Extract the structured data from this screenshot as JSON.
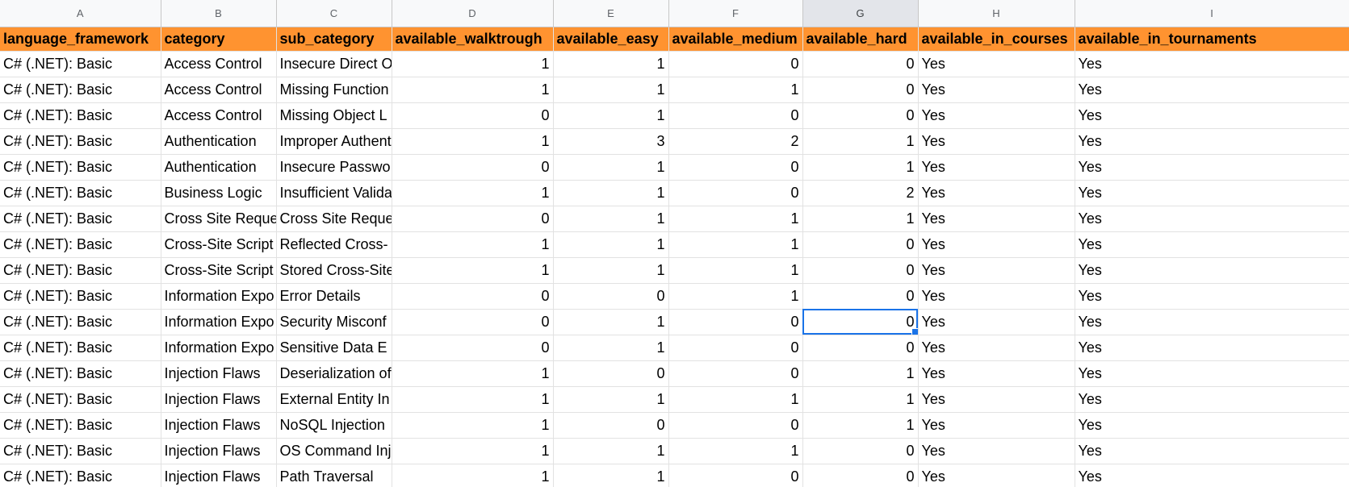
{
  "columns": [
    "A",
    "B",
    "C",
    "D",
    "E",
    "F",
    "G",
    "H",
    "I"
  ],
  "headers": [
    "language_framework",
    "category",
    "sub_category",
    "available_walktrough",
    "available_easy",
    "available_medium",
    "available_hard",
    "available_in_courses",
    "available_in_tournaments"
  ],
  "rows": [
    [
      "C# (.NET): Basic",
      "Access Control",
      "Insecure Direct O",
      "1",
      "1",
      "0",
      "0",
      "Yes",
      "Yes"
    ],
    [
      "C# (.NET): Basic",
      "Access Control",
      "Missing Function",
      "1",
      "1",
      "1",
      "0",
      "Yes",
      "Yes"
    ],
    [
      "C# (.NET): Basic",
      "Access Control",
      "Missing Object L",
      "0",
      "1",
      "0",
      "0",
      "Yes",
      "Yes"
    ],
    [
      "C# (.NET): Basic",
      "Authentication",
      "Improper Authent",
      "1",
      "3",
      "2",
      "1",
      "Yes",
      "Yes"
    ],
    [
      "C# (.NET): Basic",
      "Authentication",
      "Insecure Passwo",
      "0",
      "1",
      "0",
      "1",
      "Yes",
      "Yes"
    ],
    [
      "C# (.NET): Basic",
      "Business Logic",
      "Insufficient Valida",
      "1",
      "1",
      "0",
      "2",
      "Yes",
      "Yes"
    ],
    [
      "C# (.NET): Basic",
      "Cross Site Reque",
      "Cross Site Reque",
      "0",
      "1",
      "1",
      "1",
      "Yes",
      "Yes"
    ],
    [
      "C# (.NET): Basic",
      "Cross-Site Script",
      "Reflected Cross-",
      "1",
      "1",
      "1",
      "0",
      "Yes",
      "Yes"
    ],
    [
      "C# (.NET): Basic",
      "Cross-Site Script",
      "Stored Cross-Site",
      "1",
      "1",
      "1",
      "0",
      "Yes",
      "Yes"
    ],
    [
      "C# (.NET): Basic",
      "Information Expo",
      "Error Details",
      "0",
      "0",
      "1",
      "0",
      "Yes",
      "Yes"
    ],
    [
      "C# (.NET): Basic",
      "Information Expo",
      "Security Misconf",
      "0",
      "1",
      "0",
      "0",
      "Yes",
      "Yes"
    ],
    [
      "C# (.NET): Basic",
      "Information Expo",
      "Sensitive Data E",
      "0",
      "1",
      "0",
      "0",
      "Yes",
      "Yes"
    ],
    [
      "C# (.NET): Basic",
      "Injection Flaws",
      "Deserialization of",
      "1",
      "0",
      "0",
      "1",
      "Yes",
      "Yes"
    ],
    [
      "C# (.NET): Basic",
      "Injection Flaws",
      "External Entity In",
      "1",
      "1",
      "1",
      "1",
      "Yes",
      "Yes"
    ],
    [
      "C# (.NET): Basic",
      "Injection Flaws",
      "NoSQL Injection",
      "1",
      "0",
      "0",
      "1",
      "Yes",
      "Yes"
    ],
    [
      "C# (.NET): Basic",
      "Injection Flaws",
      "OS Command Inj",
      "1",
      "1",
      "1",
      "0",
      "Yes",
      "Yes"
    ],
    [
      "C# (.NET): Basic",
      "Injection Flaws",
      "Path Traversal",
      "1",
      "1",
      "0",
      "0",
      "Yes",
      "Yes"
    ]
  ],
  "colors": {
    "header_fill": "#ff9330",
    "selection": "#1a73e8"
  }
}
